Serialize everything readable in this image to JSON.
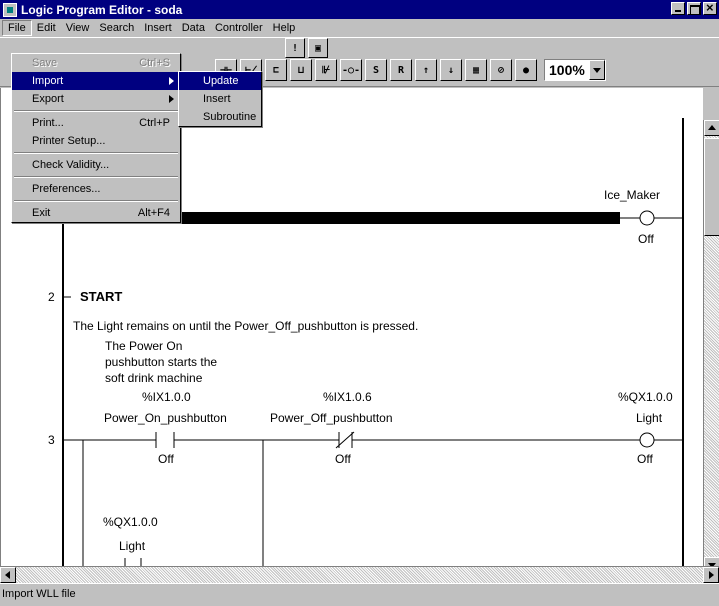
{
  "window": {
    "title": "Logic Program Editor - soda"
  },
  "menubar": {
    "items": [
      "File",
      "Edit",
      "View",
      "Search",
      "Insert",
      "Data",
      "Controller",
      "Help"
    ]
  },
  "toolbar": {
    "zoom": "100%"
  },
  "file_menu": {
    "items": [
      {
        "label": "Save",
        "shortcut": "Ctrl+S"
      },
      {
        "label": "Import",
        "shortcut": ""
      },
      {
        "label": "Export",
        "shortcut": ""
      },
      {
        "label": "Print...",
        "shortcut": "Ctrl+P"
      },
      {
        "label": "Printer Setup...",
        "shortcut": ""
      },
      {
        "label": "Check Validity...",
        "shortcut": ""
      },
      {
        "label": "Preferences...",
        "shortcut": ""
      },
      {
        "label": "Exit",
        "shortcut": "Alt+F4"
      }
    ]
  },
  "import_submenu": {
    "items": [
      "Update",
      "Insert",
      "Subroutine"
    ]
  },
  "ladder": {
    "rung1": {
      "coil_name": "Ice_Maker",
      "coil_state": "Off"
    },
    "rung2": {
      "number": "2",
      "title": "START",
      "comment": "The Light remains on until the Power_Off_pushbutton is pressed."
    },
    "rung3": {
      "number": "3",
      "note_line1": "The Power On",
      "note_line2": "pushbutton starts the",
      "note_line3": "soft drink machine",
      "contact1_addr": "%IX1.0.0",
      "contact1_name": "Power_On_pushbutton",
      "contact1_state": "Off",
      "contact2_addr": "%IX1.0.6",
      "contact2_name": "Power_Off_pushbutton",
      "contact2_state": "Off",
      "coil_addr": "%QX1.0.0",
      "coil_name": "Light",
      "coil_state": "Off",
      "branch_addr": "%QX1.0.0",
      "branch_name": "Light"
    }
  },
  "status": {
    "text": "Import WLL file"
  }
}
